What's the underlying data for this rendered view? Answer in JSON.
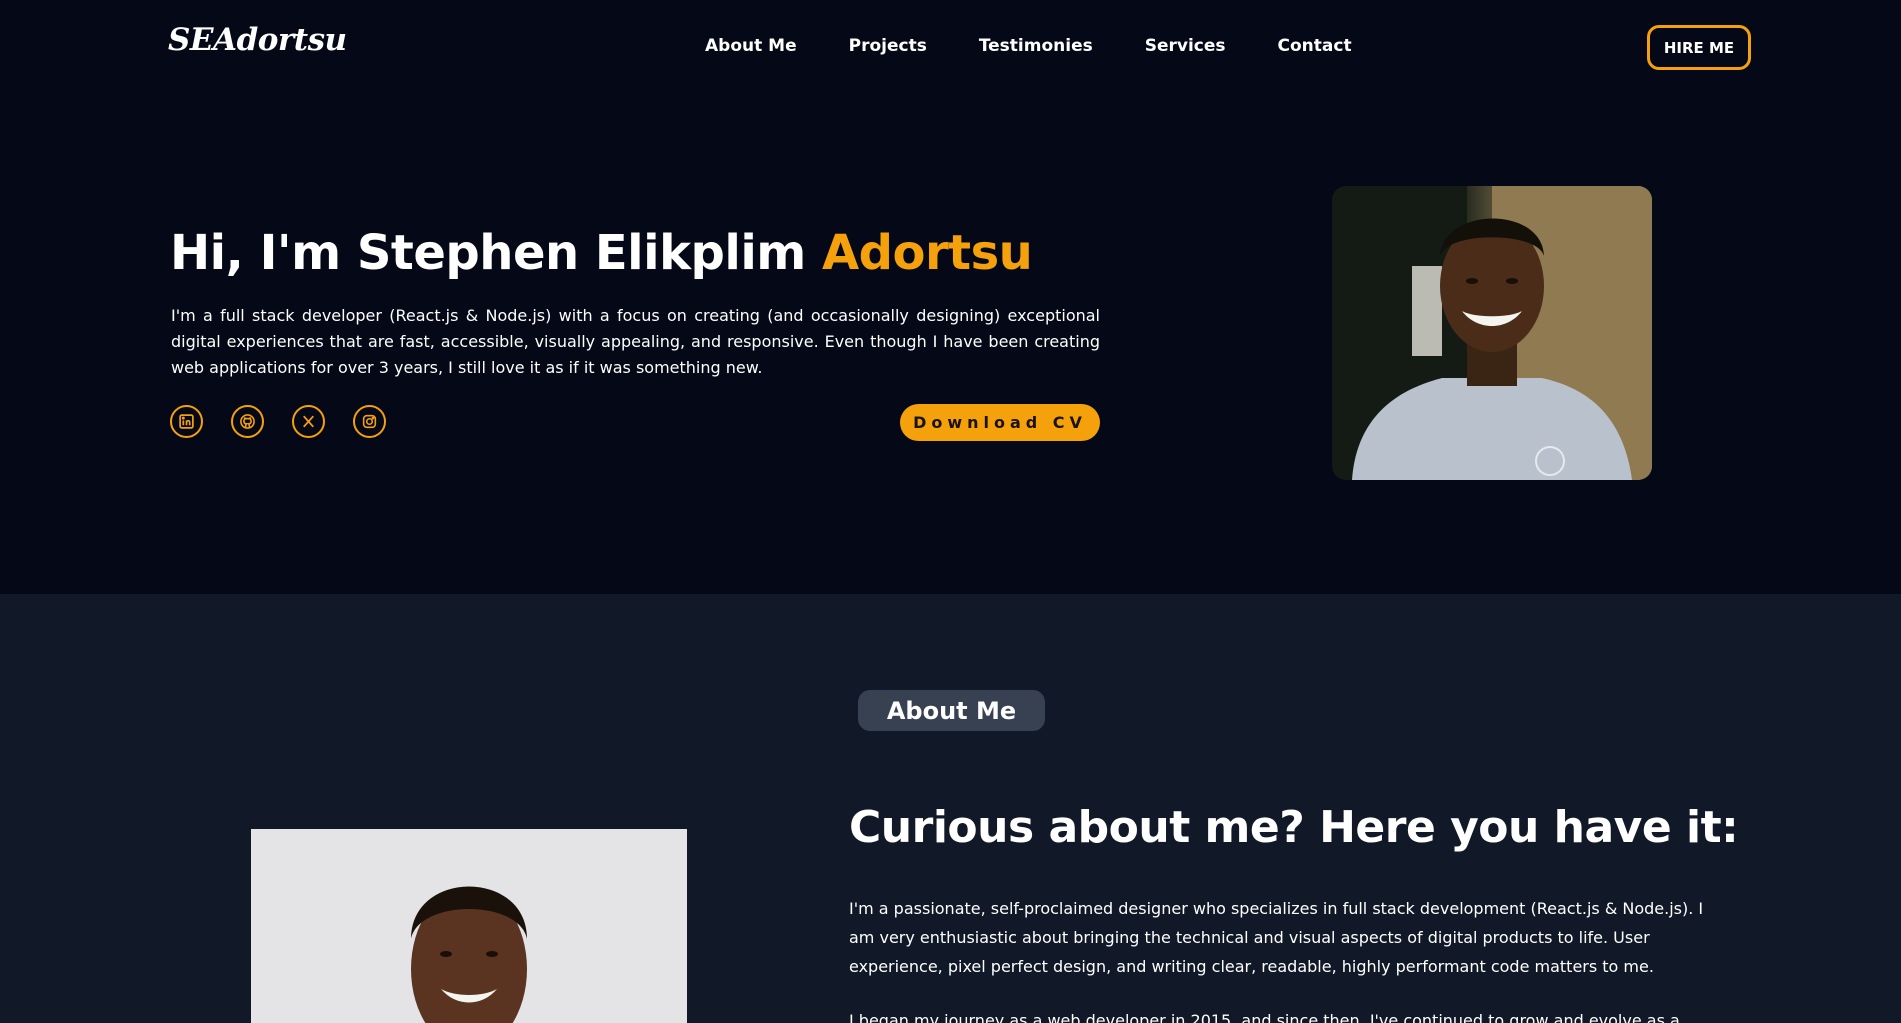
{
  "header": {
    "logo": "SEAdortsu",
    "nav": [
      "About Me",
      "Projects",
      "Testimonies",
      "Services",
      "Contact"
    ],
    "hire_label": "HIRE ME"
  },
  "hero": {
    "greeting": "Hi, I'm Stephen Elikplim ",
    "name_accent": "Adortsu",
    "description": "I'm a full stack developer (React.js & Node.js) with a focus on creating (and occasionally designing) exceptional digital experiences that are fast, accessible, visually appealing, and responsive. Even though I have been creating web applications for over 3 years, I still love it as if it was something new.",
    "socials": [
      "linkedin-icon",
      "github-icon",
      "x-icon",
      "instagram-icon"
    ],
    "cv_label": "Download CV"
  },
  "about": {
    "pill": "About Me",
    "heading": "Curious about me? Here you have it:",
    "paragraph1": "I'm a passionate, self-proclaimed designer who specializes in full stack development (React.js & Node.js). I am very enthusiastic about bringing the technical and visual aspects of digital products to life. User experience, pixel perfect design, and writing clear, readable, highly performant code matters to me.",
    "paragraph2": "I began my journey as a web developer in 2015, and since then, I've continued to grow and evolve as a"
  },
  "colors": {
    "background": "#050816",
    "section": "#111827",
    "accent": "#F5A10B"
  }
}
